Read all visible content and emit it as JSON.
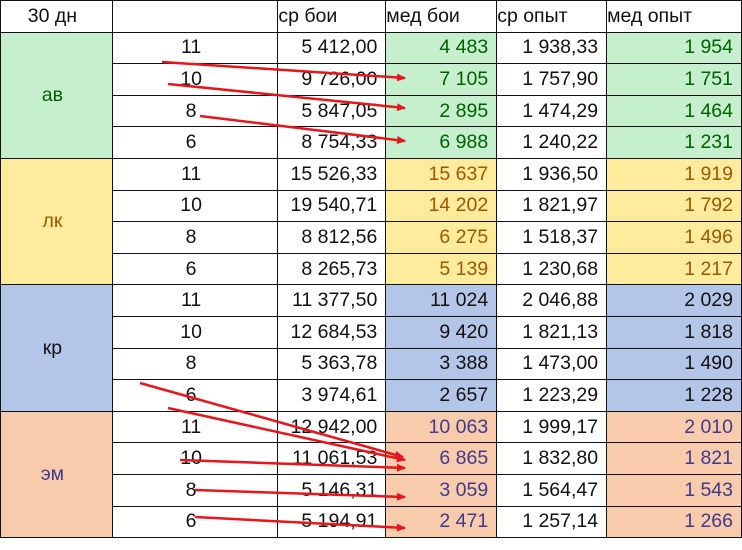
{
  "header": {
    "period": "30 дн",
    "blank": "",
    "avg_battles": "ср бои",
    "med_battles": "мед бои",
    "avg_exp": "ср опыт",
    "med_exp": "мед опыт"
  },
  "colors": {
    "av": {
      "fill": "#c6efce",
      "text": "#006100"
    },
    "lk": {
      "fill": "#ffeb9c",
      "text": "#9c5700"
    },
    "kr": {
      "fill": "#b4c6e7",
      "text": "#111111"
    },
    "em": {
      "fill": "#f8cbad",
      "text": "#403a8a"
    },
    "arrow": "#e8151b"
  },
  "groups": [
    {
      "key": "av",
      "label": "ав",
      "rows": [
        {
          "level": "11",
          "avg_battles": "5 412,00",
          "med_battles": "4 483",
          "avg_exp": "1 938,33",
          "med_exp": "1 954"
        },
        {
          "level": "10",
          "avg_battles": "9 726,00",
          "med_battles": "7 105",
          "avg_exp": "1 757,90",
          "med_exp": "1 751"
        },
        {
          "level": "8",
          "avg_battles": "5 847,05",
          "med_battles": "2 895",
          "avg_exp": "1 474,29",
          "med_exp": "1 464"
        },
        {
          "level": "6",
          "avg_battles": "8 754,33",
          "med_battles": "6 988",
          "avg_exp": "1 240,22",
          "med_exp": "1 231"
        }
      ]
    },
    {
      "key": "lk",
      "label": "лк",
      "rows": [
        {
          "level": "11",
          "avg_battles": "15 526,33",
          "med_battles": "15 637",
          "avg_exp": "1 936,50",
          "med_exp": "1 919"
        },
        {
          "level": "10",
          "avg_battles": "19 540,71",
          "med_battles": "14 202",
          "avg_exp": "1 821,97",
          "med_exp": "1 792"
        },
        {
          "level": "8",
          "avg_battles": "8 812,56",
          "med_battles": "6 275",
          "avg_exp": "1 518,37",
          "med_exp": "1 496"
        },
        {
          "level": "6",
          "avg_battles": "8 265,73",
          "med_battles": "5 139",
          "avg_exp": "1 230,68",
          "med_exp": "1 217"
        }
      ]
    },
    {
      "key": "kr",
      "label": "кр",
      "rows": [
        {
          "level": "11",
          "avg_battles": "11 377,50",
          "med_battles": "11 024",
          "avg_exp": "2 046,88",
          "med_exp": "2 029"
        },
        {
          "level": "10",
          "avg_battles": "12 684,53",
          "med_battles": "9 420",
          "avg_exp": "1 821,13",
          "med_exp": "1 818"
        },
        {
          "level": "8",
          "avg_battles": "5 363,78",
          "med_battles": "3 388",
          "avg_exp": "1 473,00",
          "med_exp": "1 490"
        },
        {
          "level": "6",
          "avg_battles": "3 974,61",
          "med_battles": "2 657",
          "avg_exp": "1 223,29",
          "med_exp": "1 228"
        }
      ]
    },
    {
      "key": "em",
      "label": "эм",
      "rows": [
        {
          "level": "11",
          "avg_battles": "12 942,00",
          "med_battles": "10 063",
          "avg_exp": "1 999,17",
          "med_exp": "2 010"
        },
        {
          "level": "10",
          "avg_battles": "11 061,53",
          "med_battles": "6 865",
          "avg_exp": "1 832,80",
          "med_exp": "1 821"
        },
        {
          "level": "8",
          "avg_battles": "5 146,31",
          "med_battles": "3 059",
          "avg_exp": "1 564,47",
          "med_exp": "1 543"
        },
        {
          "level": "6",
          "avg_battles": "5 194,91",
          "med_battles": "2 471",
          "avg_exp": "1 257,14",
          "med_exp": "1 266"
        }
      ]
    }
  ]
}
